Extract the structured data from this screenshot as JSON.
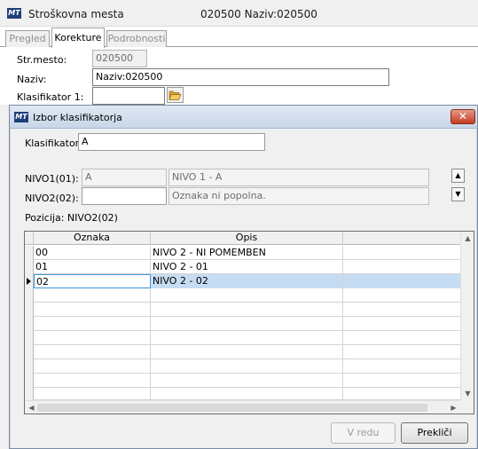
{
  "main": {
    "title": "Stroškovna mesta",
    "subtitle": "020500 Naziv:020500",
    "tabs": [
      {
        "label": "Pregled",
        "active": false
      },
      {
        "label": "Korekture",
        "active": true
      },
      {
        "label": "Podrobnosti",
        "active": false
      }
    ],
    "form": {
      "strmesto_label": "Str.mesto:",
      "strmesto_value": "020500",
      "naziv_label": "Naziv:",
      "naziv_value": "Naziv:020500",
      "klasifikator1_label": "Klasifikator 1:",
      "klasifikator1_value": ""
    }
  },
  "dialog": {
    "title": "Izbor klasifikatorja",
    "logo_text": "MT",
    "klasifikator_label": "Klasifikator:",
    "klasifikator_value": "A",
    "nivo1_label": "NIVO1(01):",
    "nivo1_code": "A",
    "nivo1_desc": "NIVO 1 - A",
    "nivo2_label": "NIVO2(02):",
    "nivo2_code": "",
    "nivo2_desc": "Oznaka ni popolna.",
    "pozicija": "Pozicija: NIVO2(02)",
    "grid": {
      "columns": [
        "Oznaka",
        "Opis",
        ""
      ],
      "rows": [
        {
          "oznaka": "00",
          "opis": "NIVO 2 - NI POMEMBEN",
          "selected": false
        },
        {
          "oznaka": "01",
          "opis": "NIVO 2 - 01",
          "selected": false
        },
        {
          "oznaka": "02",
          "opis": "NIVO 2 - 02",
          "selected": true
        }
      ]
    },
    "ok_label": "V redu",
    "cancel_label": "Prekliči"
  },
  "icons": [
    "app-logo-icon",
    "folder-open-icon",
    "close-icon",
    "arrow-up-icon",
    "arrow-down-icon",
    "row-pointer-icon"
  ],
  "colors": {
    "accent": "#3a9ad9",
    "selection": "#c6dcf2",
    "close": "#c43b22"
  }
}
